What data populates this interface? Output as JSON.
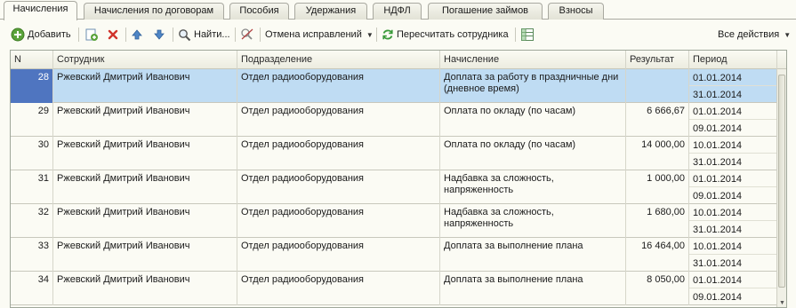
{
  "tabs": [
    {
      "label": "Начисления",
      "active": true
    },
    {
      "label": "Начисления по договорам",
      "active": false
    },
    {
      "label": "Пособия",
      "active": false
    },
    {
      "label": "Удержания",
      "active": false
    },
    {
      "label": "НДФЛ",
      "active": false
    },
    {
      "label": "Погашение займов",
      "active": false
    },
    {
      "label": "Взносы",
      "active": false
    }
  ],
  "toolbar": {
    "add_label": "Добавить",
    "find_label": "Найти...",
    "cancel_fixes_label": "Отмена исправлений",
    "recalc_label": "Пересчитать сотрудника",
    "all_actions_label": "Все действия"
  },
  "table": {
    "columns": [
      "N",
      "Сотрудник",
      "Подразделение",
      "Начисление",
      "Результат",
      "Период"
    ],
    "rows": [
      {
        "n": "28",
        "employee": "Ржевский Дмитрий Иванович",
        "dept": "Отдел радиооборудования",
        "accrual": "Доплата за работу в праздничные дни (дневное время)",
        "result": "",
        "period_start": "01.01.2014",
        "period_end": "31.01.2014",
        "selected": true
      },
      {
        "n": "29",
        "employee": "Ржевский Дмитрий Иванович",
        "dept": "Отдел радиооборудования",
        "accrual": "Оплата по окладу (по часам)",
        "result": "6 666,67",
        "period_start": "01.01.2014",
        "period_end": "09.01.2014",
        "selected": false
      },
      {
        "n": "30",
        "employee": "Ржевский Дмитрий Иванович",
        "dept": "Отдел радиооборудования",
        "accrual": "Оплата по окладу (по часам)",
        "result": "14 000,00",
        "period_start": "10.01.2014",
        "period_end": "31.01.2014",
        "selected": false
      },
      {
        "n": "31",
        "employee": "Ржевский Дмитрий Иванович",
        "dept": "Отдел радиооборудования",
        "accrual": "Надбавка за сложность, напряженность",
        "result": "1 000,00",
        "period_start": "01.01.2014",
        "period_end": "09.01.2014",
        "selected": false
      },
      {
        "n": "32",
        "employee": "Ржевский Дмитрий Иванович",
        "dept": "Отдел радиооборудования",
        "accrual": "Надбавка за сложность, напряженность",
        "result": "1 680,00",
        "period_start": "10.01.2014",
        "period_end": "31.01.2014",
        "selected": false
      },
      {
        "n": "33",
        "employee": "Ржевский Дмитрий Иванович",
        "dept": "Отдел радиооборудования",
        "accrual": "Доплата за выполнение плана",
        "result": "16 464,00",
        "period_start": "10.01.2014",
        "period_end": "31.01.2014",
        "selected": false
      },
      {
        "n": "34",
        "employee": "Ржевский Дмитрий Иванович",
        "dept": "Отдел радиооборудования",
        "accrual": "Доплата за выполнение плана",
        "result": "8 050,00",
        "period_start": "01.01.2014",
        "period_end": "09.01.2014",
        "selected": false
      }
    ]
  }
}
